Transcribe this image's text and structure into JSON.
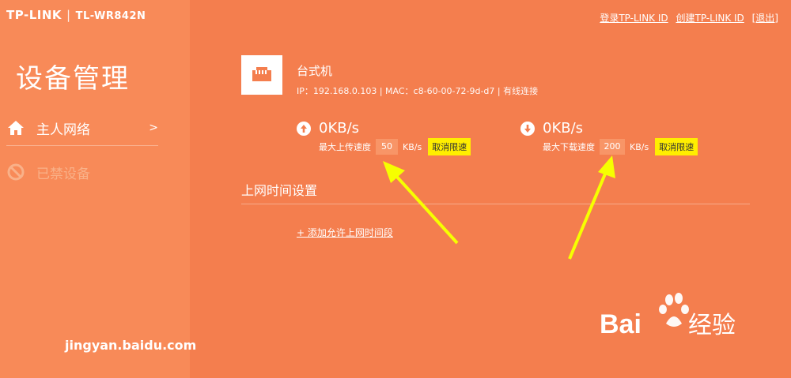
{
  "header": {
    "brand": "TP-LINK",
    "separator": "|",
    "model": "TL-WR842N",
    "links": {
      "login": "登录TP-LINK ID",
      "create": "创建TP-LINK ID",
      "logout": "[退出]"
    }
  },
  "sidebar": {
    "title": "设备管理",
    "items": [
      {
        "label": "主人网络",
        "icon": "home-icon",
        "chevron": ">"
      },
      {
        "label": "已禁设备",
        "icon": "ban-icon"
      }
    ]
  },
  "device": {
    "name": "台式机",
    "icon": "ethernet-port-icon",
    "info": "IP：192.168.0.103 | MAC：c8-60-00-72-9d-d7 | 有线连接"
  },
  "upload": {
    "value": "0KB/s",
    "limit_label": "最大上传速度",
    "limit_value": "50",
    "unit": "KB/s",
    "cancel": "取消限速",
    "icon": "arrow-up-circle-icon"
  },
  "download": {
    "value": "0KB/s",
    "limit_label": "最大下载速度",
    "limit_value": "200",
    "unit": "KB/s",
    "cancel": "取消限速",
    "icon": "arrow-down-circle-icon"
  },
  "schedule": {
    "title": "上网时间设置",
    "add_link": "+ 添加允许上网时间段"
  },
  "watermark": {
    "text": "jingyan.baidu.com",
    "logo_text": "Bai du 经验"
  },
  "colors": {
    "background": "#f47e4e",
    "sidebar": "#f88a58",
    "highlight_button": "#ffee00",
    "annotation_arrow": "#f6ff00"
  }
}
